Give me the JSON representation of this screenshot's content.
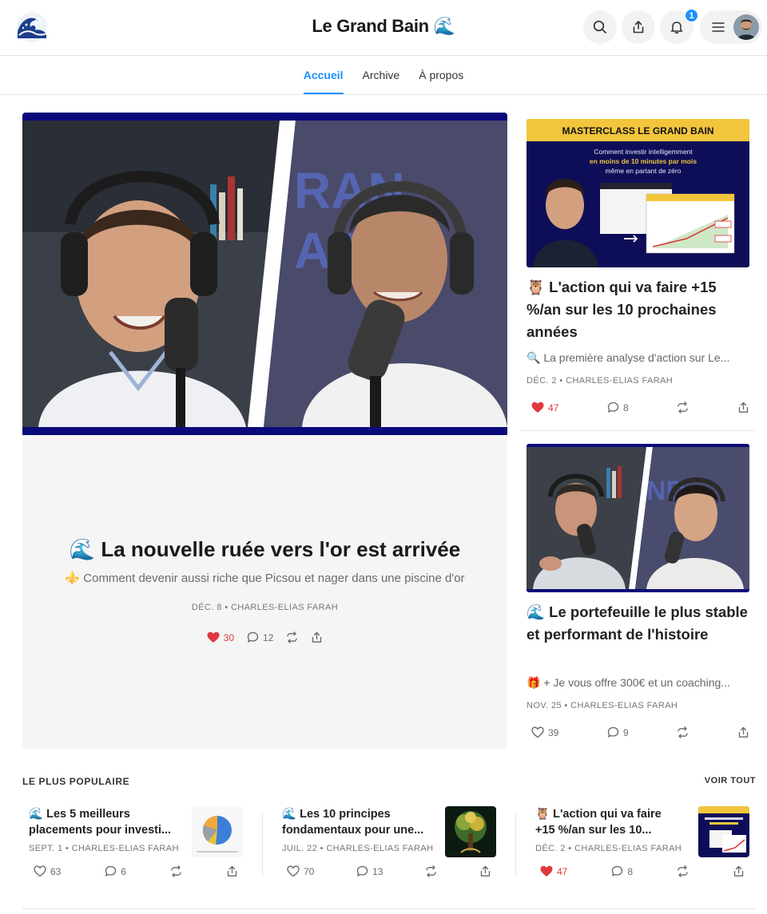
{
  "header": {
    "title": "Le Grand Bain 🌊",
    "notification_count": "1"
  },
  "nav": {
    "tabs": [
      {
        "label": "Accueil",
        "active": true
      },
      {
        "label": "Archive",
        "active": false
      },
      {
        "label": "À propos",
        "active": false
      }
    ]
  },
  "hero": {
    "title": "🌊 La nouvelle ruée vers l'or est arrivée",
    "subtitle": "⚜️ Comment devenir aussi riche que Picsou et nager dans une piscine d'or",
    "meta": "DÉC. 8 • CHARLES-ELIAS FARAH",
    "likes": "30",
    "comments": "12",
    "liked": true
  },
  "side_posts": [
    {
      "image_banner": "MASTERCLASS LE GRAND BAIN",
      "image_text_1": "Comment investir intelligemment",
      "image_text_2": "en moins de 10 minutes par mois",
      "image_text_3": "même en partant de zéro",
      "title": "🦉 L'action qui va faire +15 %/an sur les 10 prochaines années",
      "subtitle": "🔍 La première analyse d'action sur Le...",
      "meta": "DÉC. 2 • CHARLES-ELIAS FARAH",
      "likes": "47",
      "comments": "8",
      "liked": true
    },
    {
      "title": "🌊 Le portefeuille le plus stable et performant de l'histoire",
      "subtitle": "🎁 + Je vous offre 300€ et un coaching...",
      "meta": "NOV. 25 • CHARLES-ELIAS FARAH",
      "likes": "39",
      "comments": "9",
      "liked": false
    }
  ],
  "popular": {
    "heading": "LE PLUS POPULAIRE",
    "see_all": "VOIR TOUT",
    "items": [
      {
        "title_1": "🌊 Les 5 meilleurs",
        "title_2": "placements pour investi...",
        "meta": "SEPT. 1 • CHARLES-ELIAS FARAH",
        "likes": "63",
        "comments": "6",
        "liked": false
      },
      {
        "title_1": "🌊 Les 10 principes",
        "title_2": "fondamentaux pour une...",
        "meta": "JUIL. 22 • CHARLES-ELIAS FARAH",
        "likes": "70",
        "comments": "13",
        "liked": false
      },
      {
        "title_1": "🦉 L'action qui va faire",
        "title_2": "+15 %/an sur les 10...",
        "meta": "DÉC. 2 • CHARLES-ELIAS FARAH",
        "likes": "47",
        "comments": "8",
        "liked": true
      }
    ]
  },
  "colors": {
    "accent": "#1e90ff",
    "like": "#e0393e",
    "navy_frame": "#0a0a7a"
  }
}
